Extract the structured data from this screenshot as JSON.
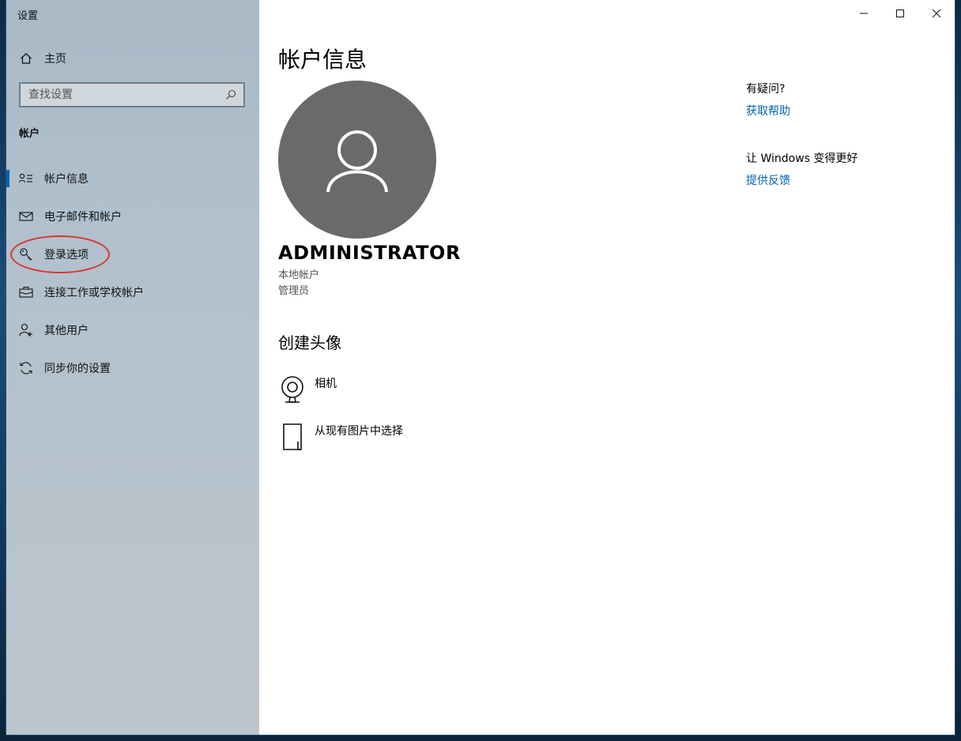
{
  "app": {
    "title": "设置"
  },
  "sidebar": {
    "home_label": "主页",
    "search_placeholder": "查找设置",
    "section_title": "帐户",
    "items": [
      {
        "label": "帐户信息",
        "icon": "account-info-icon",
        "active": true
      },
      {
        "label": "电子邮件和帐户",
        "icon": "mail-icon"
      },
      {
        "label": "登录选项",
        "icon": "key-icon"
      },
      {
        "label": "连接工作或学校帐户",
        "icon": "briefcase-icon"
      },
      {
        "label": "其他用户",
        "icon": "person-add-icon"
      },
      {
        "label": "同步你的设置",
        "icon": "sync-icon"
      }
    ]
  },
  "main": {
    "page_title": "帐户信息",
    "user": {
      "name": "ADMINISTRATOR",
      "account_type": "本地帐户",
      "role": "管理员"
    },
    "create_avatar": {
      "title": "创建头像",
      "options": [
        {
          "label": "相机",
          "icon": "webcam-icon"
        },
        {
          "label": "从现有图片中选择",
          "icon": "file-icon"
        }
      ]
    }
  },
  "side_panel": {
    "help_heading": "有疑问?",
    "help_link": "获取帮助",
    "feedback_heading": "让 Windows 变得更好",
    "feedback_link": "提供反馈"
  },
  "colors": {
    "accent": "#0063b1",
    "annotation": "#d9352f",
    "avatar_bg": "#6a6a6a"
  }
}
